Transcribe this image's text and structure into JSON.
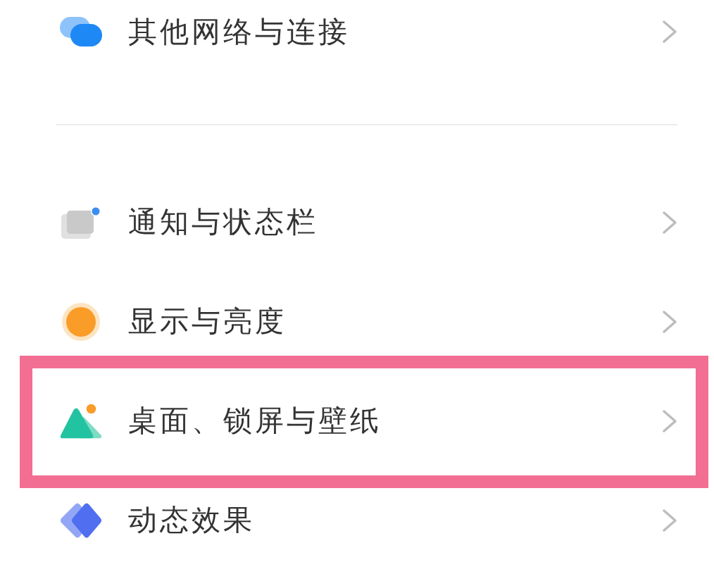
{
  "groups": [
    {
      "items": [
        {
          "label": "其他网络与连接",
          "kind": "network",
          "highlighted": false
        }
      ]
    },
    {
      "items": [
        {
          "label": "通知与状态栏",
          "kind": "notification",
          "highlighted": false
        },
        {
          "label": "显示与亮度",
          "kind": "display",
          "highlighted": false
        },
        {
          "label": "桌面、锁屏与壁纸",
          "kind": "wallpaper",
          "highlighted": true
        },
        {
          "label": "动态效果",
          "kind": "effects",
          "highlighted": false
        }
      ]
    }
  ]
}
